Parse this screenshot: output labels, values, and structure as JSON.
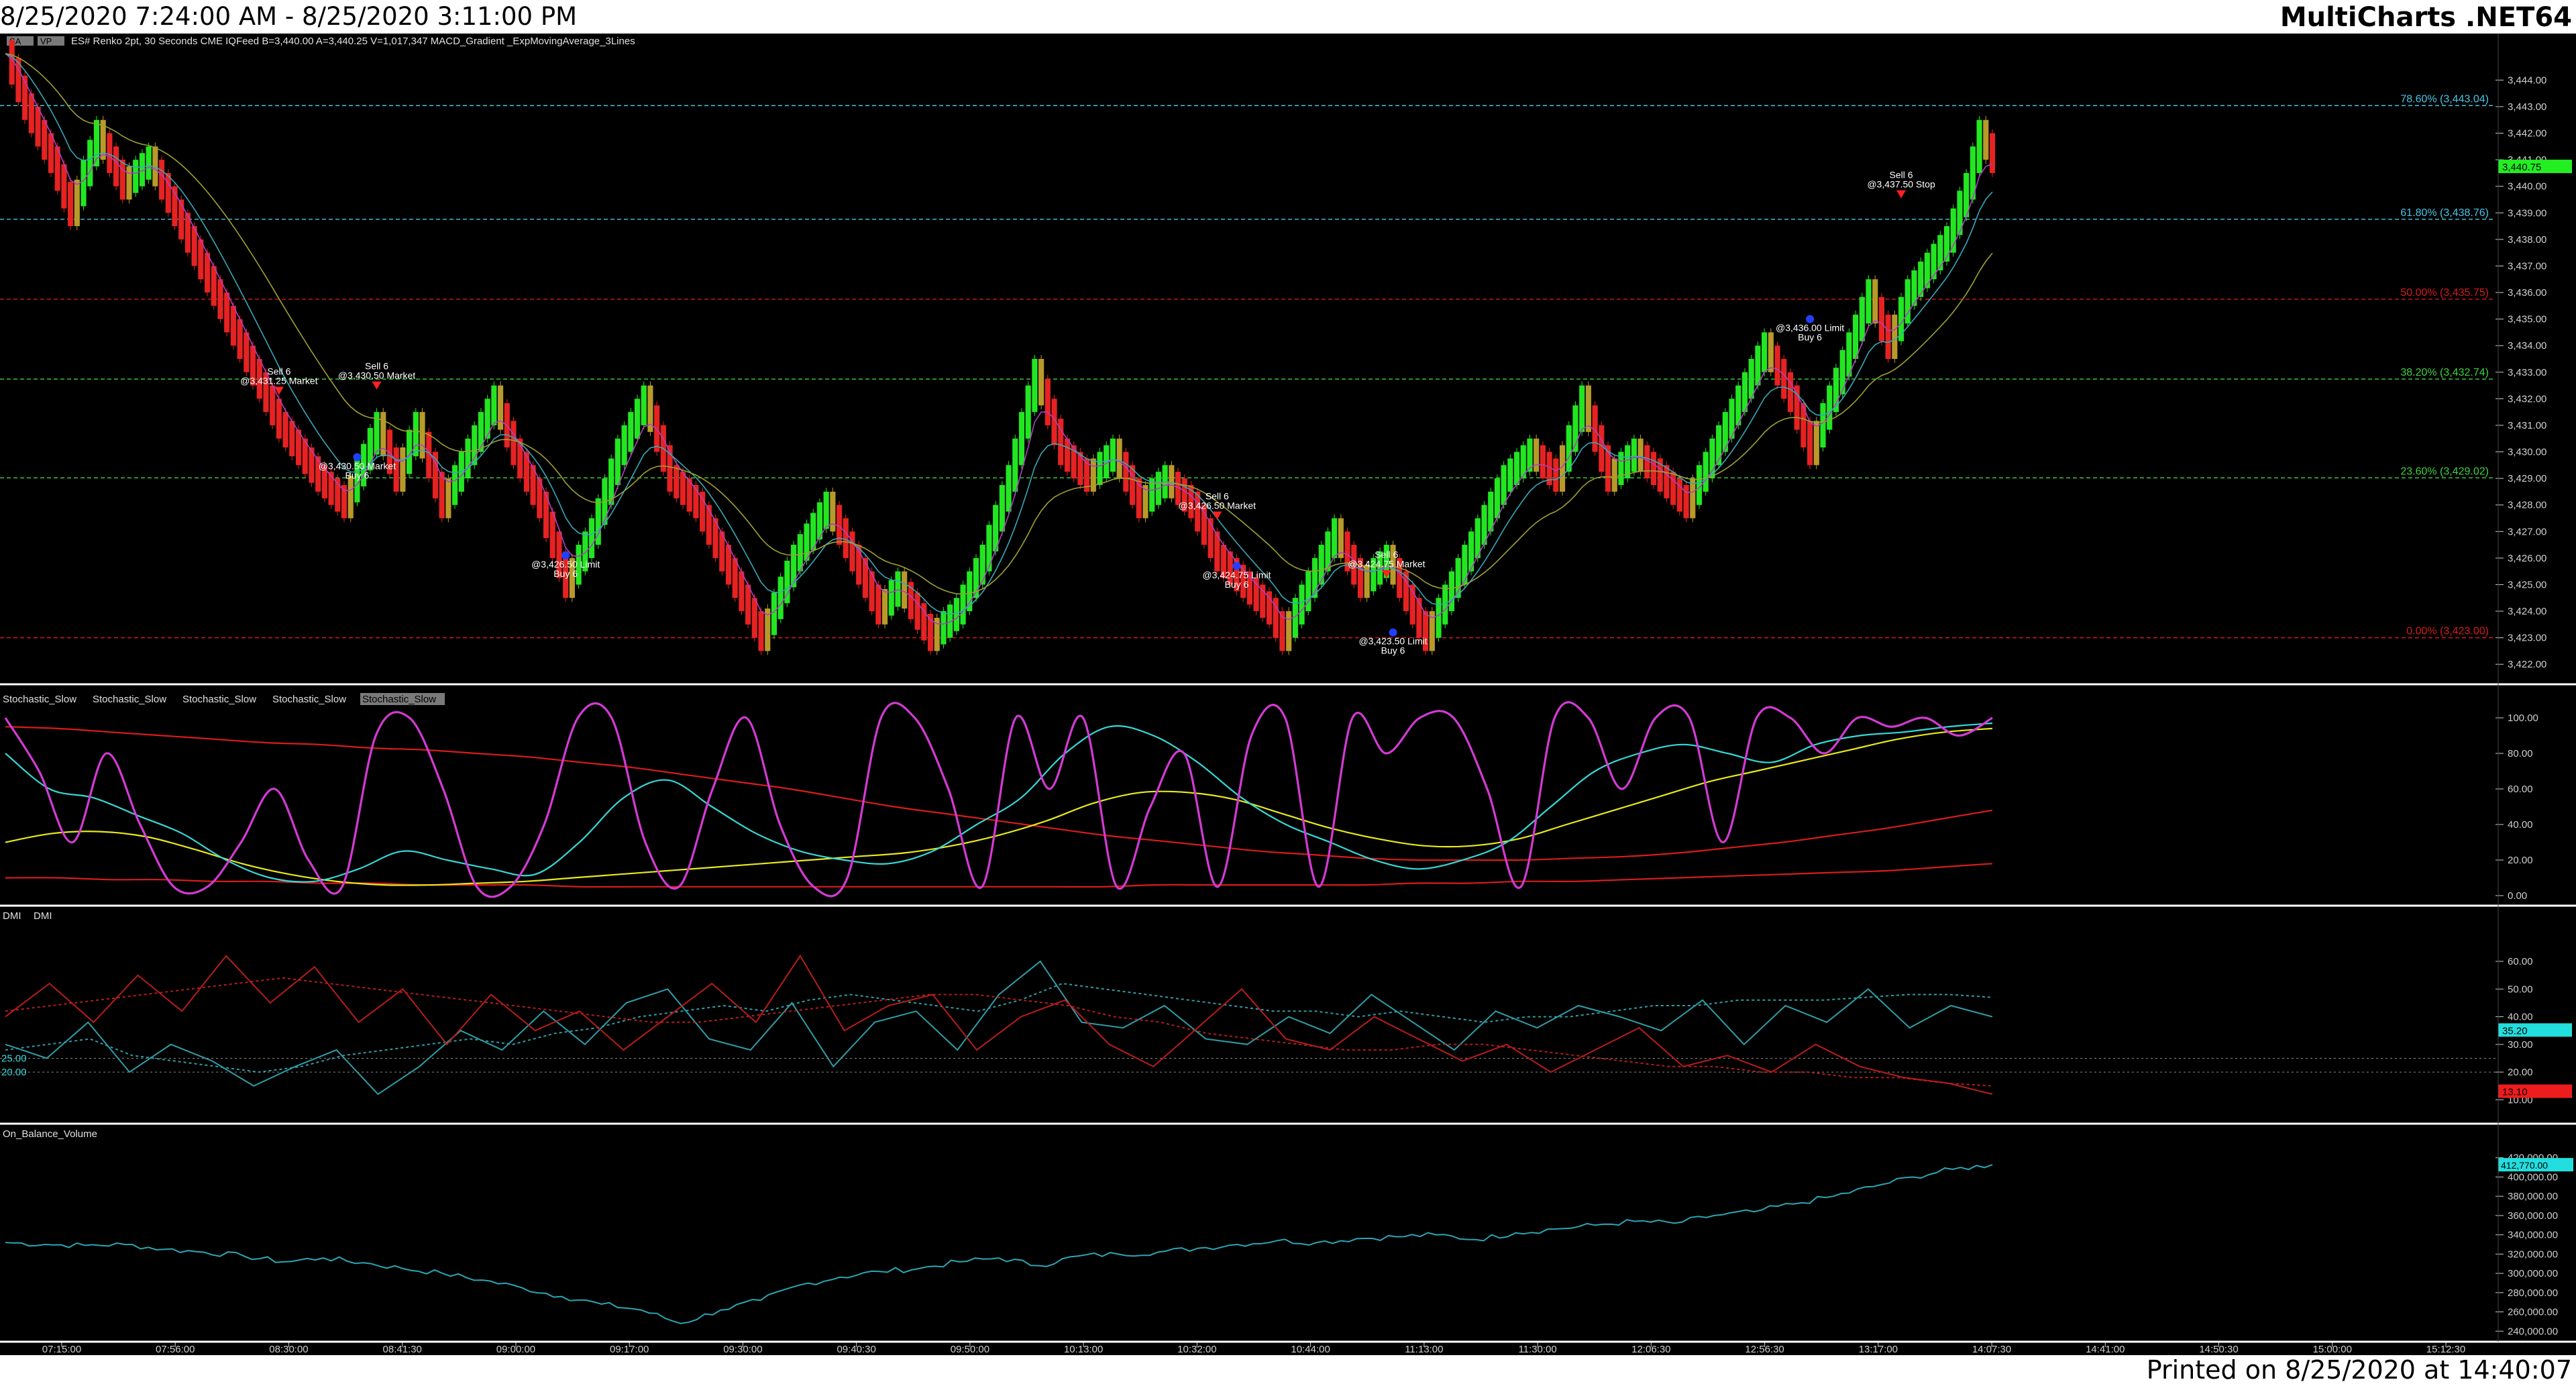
{
  "header": {
    "date_range": "8/25/2020 7:24:00 AM - 8/25/2020 3:11:00 PM",
    "app": "MultiCharts .NET64"
  },
  "footer": {
    "printed": "Printed on 8/25/2020 at 14:40:07"
  },
  "colors": {
    "background": "#000000",
    "separator": "#ffffff",
    "axis_text": "#cfcfcf",
    "bull": "#22e622",
    "bear": "#e62222",
    "neutral": "#b89a2a",
    "fib_786": "#49c6e6",
    "fib_618": "#49c6e6",
    "fib_500": "#d21c1c",
    "fib_382": "#3ed23e",
    "fib_236": "#3ed23e",
    "fib_000": "#d21c1c",
    "stoch_magenta": "#d43ad4",
    "stoch_cyan": "#36d8d8",
    "stoch_yellow": "#e8e81c",
    "stoch_red": "#d81c1c",
    "dmi_cyan": "#2e9ea8",
    "dmi_red": "#b81c1c",
    "obv": "#2aa6b4",
    "price_tag": "#22ee22",
    "dmi_tag": "#22dede",
    "dmi_red_tag": "#ee1c1c",
    "obv_tag": "#22dede"
  },
  "price_panel": {
    "legend": [
      "ES#",
      "Renko 2pt, 30 Seconds",
      "CME",
      "IQFeed",
      "B=3,440.00",
      "A=3,440.25",
      "V=1,017,347",
      "MACD_Gradient",
      "_ExpMovingAverage_3Lines"
    ],
    "badges": [
      "SA",
      "VP"
    ],
    "last_price": "3,440.75",
    "axis_labels": [
      "3,444.00",
      "3,443.00",
      "3,442.00",
      "3,441.00",
      "3,440.00",
      "3,439.00",
      "3,438.00",
      "3,437.00",
      "3,436.00",
      "3,435.00",
      "3,434.00",
      "3,433.00",
      "3,432.00",
      "3,431.00",
      "3,430.00",
      "3,429.00",
      "3,428.00",
      "3,427.00",
      "3,426.00",
      "3,425.00",
      "3,424.00",
      "3,423.00",
      "3,422.00"
    ],
    "fib_levels": [
      {
        "label": "78.60% (3,443.04)",
        "value": 3443.04,
        "color_key": "fib_786"
      },
      {
        "label": "61.80% (3,438.76)",
        "value": 3438.76,
        "color_key": "fib_618"
      },
      {
        "label": "50.00% (3,435.75)",
        "value": 3435.75,
        "color_key": "fib_500"
      },
      {
        "label": "38.20% (3,432.74)",
        "value": 3432.74,
        "color_key": "fib_382"
      },
      {
        "label": "23.60% (3,429.02)",
        "value": 3429.02,
        "color_key": "fib_236"
      },
      {
        "label": "0.00% (3,423.00)",
        "value": 3423.0,
        "color_key": "fib_000"
      }
    ],
    "trades": [
      {
        "bar": 42,
        "price": 3432.3,
        "lines": [
          "Sell 6",
          "@3,431.25 Market"
        ],
        "side": "sell"
      },
      {
        "bar": 57,
        "price": 3432.5,
        "lines": [
          "Sell 6",
          "@3,430.50 Market"
        ],
        "side": "sell"
      },
      {
        "bar": 54,
        "price": 3429.8,
        "lines": [
          "@3,430.50 Market",
          "Buy 6"
        ],
        "side": "buy"
      },
      {
        "bar": 86,
        "price": 3426.1,
        "lines": [
          "@3,426.50 Limit",
          "Buy 6"
        ],
        "side": "buy"
      },
      {
        "bar": 186,
        "price": 3427.6,
        "lines": [
          "Sell 6",
          "@3,426.50 Market"
        ],
        "side": "sell"
      },
      {
        "bar": 189,
        "price": 3425.7,
        "lines": [
          "@3,424.75 Limit",
          "Buy 6"
        ],
        "side": "buy"
      },
      {
        "bar": 212,
        "price": 3425.4,
        "lines": [
          "Sell 6",
          "@3,424.75 Market"
        ],
        "side": "sell"
      },
      {
        "bar": 213,
        "price": 3423.2,
        "lines": [
          "@3,423.50 Limit",
          "Buy 6"
        ],
        "side": "buy"
      },
      {
        "bar": 277,
        "price": 3435.0,
        "lines": [
          "@3,436.00 Limit",
          "Buy 6"
        ],
        "side": "buy"
      },
      {
        "bar": 291,
        "price": 3439.7,
        "lines": [
          "Sell 6",
          "@3,437.50 Stop"
        ],
        "side": "sell"
      }
    ]
  },
  "stoch_panel": {
    "legend": [
      "Stochastic_Slow",
      "Stochastic_Slow",
      "Stochastic_Slow",
      "Stochastic_Slow",
      "Stochastic_Slow"
    ],
    "axis_labels": [
      "100.00",
      "80.00",
      "60.00",
      "40.00",
      "20.00",
      "0.00"
    ]
  },
  "dmi_panel": {
    "legend": [
      "DMI",
      "DMI"
    ],
    "axis_labels": [
      "60.00",
      "50.00",
      "40.00",
      "30.00",
      "20.00",
      "10.00"
    ],
    "left_labels": [
      "25.00",
      "20.00"
    ],
    "tags": [
      "35.20",
      "13.10"
    ]
  },
  "obv_panel": {
    "legend": [
      "On_Balance_Volume"
    ],
    "axis_labels": [
      "420,000.00",
      "400,000.00",
      "380,000.00",
      "360,000.00",
      "340,000.00",
      "320,000.00",
      "300,000.00",
      "280,000.00",
      "260,000.00",
      "240,000.00"
    ],
    "tag": "412,770.00"
  },
  "time_axis": [
    "07:15:00",
    "07:56:00",
    "08:30:00",
    "08:41:30",
    "09:00:00",
    "09:17:00",
    "09:30:00",
    "09:40:30",
    "09:50:00",
    "10:13:00",
    "10:32:00",
    "10:44:00",
    "11:13:00",
    "11:30:00",
    "12:06:30",
    "12:56:30",
    "13:17:00",
    "14:07:30",
    "14:41:00",
    "14:50:30",
    "15:00:00",
    "15:12:30"
  ],
  "chart_data": {
    "type": "line",
    "description_units": "Renko 2pt bars of ES# with indicator panels",
    "price": {
      "ylim": [
        3421.5,
        3445.5
      ],
      "box_size": 1,
      "waypoints": [
        [
          0,
          3445
        ],
        [
          3,
          3443
        ],
        [
          7,
          3441
        ],
        [
          10,
          3439
        ],
        [
          14,
          3442
        ],
        [
          18,
          3440
        ],
        [
          22,
          3441
        ],
        [
          26,
          3439
        ],
        [
          30,
          3437
        ],
        [
          36,
          3434
        ],
        [
          42,
          3431
        ],
        [
          48,
          3429
        ],
        [
          52,
          3428
        ],
        [
          57,
          3431
        ],
        [
          60,
          3429
        ],
        [
          63,
          3431
        ],
        [
          67,
          3428
        ],
        [
          71,
          3430
        ],
        [
          75,
          3432
        ],
        [
          78,
          3430
        ],
        [
          82,
          3428
        ],
        [
          86,
          3425
        ],
        [
          90,
          3427
        ],
        [
          94,
          3430
        ],
        [
          98,
          3432
        ],
        [
          102,
          3429
        ],
        [
          106,
          3428
        ],
        [
          110,
          3426
        ],
        [
          116,
          3423
        ],
        [
          121,
          3426
        ],
        [
          126,
          3428
        ],
        [
          130,
          3426
        ],
        [
          134,
          3424
        ],
        [
          137,
          3425
        ],
        [
          142,
          3423
        ],
        [
          146,
          3424
        ],
        [
          150,
          3426
        ],
        [
          154,
          3429
        ],
        [
          158,
          3433
        ],
        [
          162,
          3430
        ],
        [
          166,
          3429
        ],
        [
          170,
          3430
        ],
        [
          174,
          3428
        ],
        [
          178,
          3429
        ],
        [
          182,
          3428
        ],
        [
          186,
          3426
        ],
        [
          190,
          3425
        ],
        [
          194,
          3424
        ],
        [
          196,
          3423
        ],
        [
          200,
          3425
        ],
        [
          204,
          3427
        ],
        [
          208,
          3425
        ],
        [
          212,
          3426
        ],
        [
          216,
          3424
        ],
        [
          218,
          3423
        ],
        [
          222,
          3425
        ],
        [
          226,
          3427
        ],
        [
          230,
          3429
        ],
        [
          234,
          3430
        ],
        [
          238,
          3429
        ],
        [
          242,
          3432
        ],
        [
          246,
          3429
        ],
        [
          250,
          3430
        ],
        [
          254,
          3429
        ],
        [
          258,
          3428
        ],
        [
          262,
          3430
        ],
        [
          266,
          3432
        ],
        [
          270,
          3434
        ],
        [
          274,
          3432
        ],
        [
          277,
          3430
        ],
        [
          280,
          3432
        ],
        [
          283,
          3434
        ],
        [
          286,
          3436
        ],
        [
          289,
          3434
        ],
        [
          292,
          3436
        ],
        [
          295,
          3437
        ],
        [
          298,
          3438
        ],
        [
          301,
          3440
        ],
        [
          303,
          3442
        ],
        [
          305,
          3441
        ]
      ]
    },
    "stochastic": {
      "ylim": [
        0,
        100
      ],
      "series": [
        {
          "color_key": "stoch_red",
          "values": [
            95,
            94,
            92,
            90,
            88,
            86,
            85,
            83,
            82,
            80,
            78,
            75,
            72,
            68,
            64,
            60,
            55,
            50,
            46,
            42,
            38,
            34,
            31,
            28,
            25,
            23,
            21,
            20,
            20,
            20,
            21,
            22,
            24,
            27,
            30,
            34,
            38,
            43,
            48
          ]
        },
        {
          "color_key": "stoch_red",
          "values": [
            10,
            10,
            9,
            9,
            8,
            8,
            7,
            7,
            6,
            6,
            6,
            5,
            5,
            5,
            5,
            5,
            5,
            5,
            5,
            5,
            5,
            5,
            6,
            6,
            6,
            6,
            6,
            7,
            7,
            8,
            8,
            9,
            10,
            11,
            12,
            13,
            14,
            16,
            18
          ]
        },
        {
          "color_key": "stoch_yellow",
          "values": [
            30,
            35,
            36,
            33,
            26,
            18,
            12,
            8,
            6,
            6,
            7,
            8,
            10,
            12,
            14,
            16,
            18,
            20,
            22,
            24,
            28,
            34,
            42,
            52,
            58,
            58,
            54,
            46,
            38,
            32,
            28,
            28,
            32,
            40,
            48,
            56,
            64,
            70,
            76,
            82,
            88,
            92,
            94
          ]
        },
        {
          "color_key": "stoch_cyan",
          "values": [
            80,
            60,
            55,
            45,
            35,
            20,
            10,
            8,
            15,
            25,
            20,
            15,
            12,
            30,
            55,
            65,
            50,
            35,
            25,
            20,
            18,
            25,
            40,
            55,
            80,
            95,
            90,
            75,
            55,
            40,
            30,
            20,
            15,
            20,
            30,
            50,
            70,
            80,
            85,
            80,
            75,
            85,
            90,
            92,
            95,
            97
          ]
        },
        {
          "color_key": "stoch_magenta",
          "values": [
            100,
            70,
            30,
            80,
            40,
            5,
            5,
            30,
            60,
            20,
            5,
            90,
            100,
            60,
            5,
            5,
            40,
            100,
            100,
            30,
            5,
            60,
            100,
            40,
            5,
            10,
            100,
            100,
            60,
            5,
            100,
            60,
            100,
            5,
            50,
            80,
            5,
            90,
            100,
            5,
            100,
            80,
            100,
            100,
            60,
            5,
            100,
            100,
            60,
            100,
            100,
            30,
            100,
            100,
            80,
            100,
            95,
            100,
            90,
            100
          ]
        }
      ]
    },
    "dmi": {
      "ylim": [
        5,
        68
      ],
      "series": [
        {
          "color_key": "dmi_cyan",
          "dashed": false,
          "values": [
            30,
            25,
            38,
            20,
            30,
            24,
            15,
            22,
            28,
            12,
            22,
            35,
            28,
            42,
            30,
            45,
            50,
            32,
            28,
            45,
            22,
            38,
            42,
            28,
            48,
            60,
            38,
            36,
            44,
            32,
            30,
            40,
            34,
            48,
            38,
            28,
            42,
            36,
            44,
            40,
            35,
            46,
            30,
            44,
            38,
            50,
            36,
            44,
            40
          ]
        },
        {
          "color_key": "dmi_cyan",
          "dashed": true,
          "values": [
            28,
            30,
            32,
            26,
            24,
            22,
            20,
            22,
            26,
            28,
            30,
            32,
            30,
            34,
            36,
            40,
            42,
            44,
            42,
            46,
            48,
            46,
            44,
            42,
            46,
            52,
            50,
            48,
            46,
            44,
            42,
            42,
            40,
            42,
            40,
            38,
            40,
            40,
            42,
            44,
            44,
            46,
            46,
            46,
            47,
            48,
            48,
            47
          ]
        },
        {
          "color_key": "dmi_red",
          "dashed": false,
          "values": [
            40,
            52,
            38,
            55,
            42,
            62,
            45,
            58,
            38,
            50,
            30,
            48,
            35,
            42,
            28,
            40,
            52,
            38,
            62,
            35,
            44,
            48,
            28,
            40,
            46,
            30,
            22,
            36,
            50,
            32,
            28,
            40,
            32,
            24,
            30,
            20,
            28,
            36,
            22,
            26,
            20,
            30,
            22,
            18,
            16,
            12
          ]
        },
        {
          "color_key": "dmi_red",
          "dashed": true,
          "values": [
            42,
            44,
            46,
            48,
            50,
            52,
            54,
            52,
            50,
            48,
            46,
            44,
            42,
            40,
            38,
            38,
            40,
            42,
            44,
            46,
            48,
            48,
            46,
            44,
            40,
            38,
            34,
            32,
            30,
            28,
            28,
            30,
            30,
            28,
            26,
            24,
            22,
            22,
            20,
            20,
            18,
            18,
            16,
            15
          ]
        }
      ]
    },
    "obv": {
      "ylim": [
        236000,
        424000
      ],
      "values": [
        332000,
        330000,
        329000,
        330000,
        325000,
        322000,
        318000,
        312000,
        316000,
        311000,
        305000,
        300000,
        293000,
        285000,
        276000,
        268000,
        262000,
        248000,
        262000,
        272000,
        288000,
        296000,
        302000,
        305000,
        312000,
        316000,
        308000,
        318000,
        320000,
        322000,
        326000,
        330000,
        334000,
        332000,
        336000,
        338000,
        340000,
        335000,
        342000,
        346000,
        350000,
        354000,
        352000,
        360000,
        364000,
        372000,
        380000,
        390000,
        400000,
        408000,
        412770
      ]
    }
  }
}
